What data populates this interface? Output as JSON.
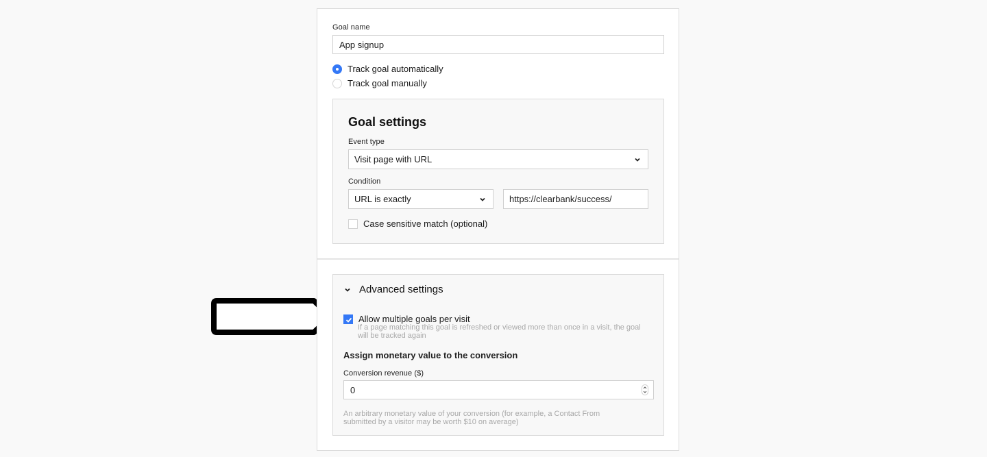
{
  "goal_name": {
    "label": "Goal name",
    "value": "App signup"
  },
  "tracking": {
    "options": [
      {
        "label": "Track goal automatically",
        "checked": true
      },
      {
        "label": "Track goal manually",
        "checked": false
      }
    ]
  },
  "goal_settings": {
    "title": "Goal settings",
    "event_type": {
      "label": "Event type",
      "selected": "Visit page with URL"
    },
    "condition": {
      "label": "Condition",
      "selected": "URL is exactly",
      "url_value": "https://clearbank/success/"
    },
    "case_sensitive": {
      "label": "Case sensitive match (optional)",
      "checked": false
    }
  },
  "advanced_settings": {
    "title": "Advanced settings",
    "expanded": true,
    "allow_multiple": {
      "label": "Allow multiple goals per visit",
      "checked": true,
      "hint": "If a page matching this goal is refreshed or viewed more than once in a visit, the goal will be tracked again"
    },
    "monetary": {
      "heading": "Assign monetary value to the conversion",
      "revenue_label": "Conversion revenue ($)",
      "revenue_value": "0",
      "hint": "An arbitrary monetary value of your conversion (for example, a Contact From submitted by a visitor may be worth $10 on average)"
    }
  },
  "colors": {
    "accent": "#3478f6",
    "page_background": "#f9f9f9",
    "panel_background": "#f8f8f8",
    "hint_text": "#a8a8a8"
  }
}
